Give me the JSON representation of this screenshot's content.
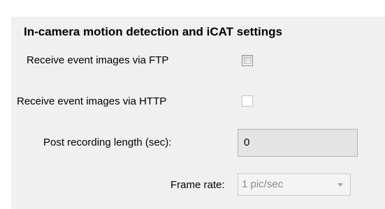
{
  "section": {
    "title": "In-camera motion detection and iCAT settings"
  },
  "ftp": {
    "label": "Receive event images via FTP",
    "checked": false
  },
  "http": {
    "label": "Receive event images via HTTP",
    "checked": false,
    "enabled": false
  },
  "post_recording": {
    "label": "Post recording length (sec):",
    "value": "0"
  },
  "frame_rate": {
    "label": "Frame rate:",
    "selected": "1 pic/sec",
    "icon": "chevron-down-icon"
  }
}
